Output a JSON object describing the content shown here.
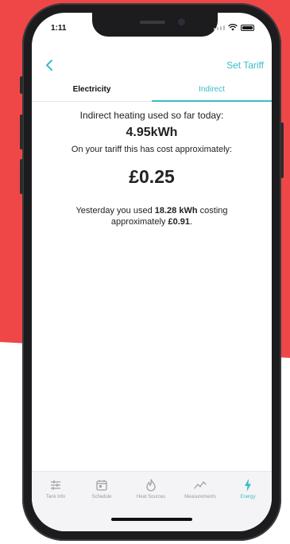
{
  "status": {
    "time": "1:11"
  },
  "nav": {
    "back_icon": "chevron-left-icon",
    "right_action": "Set Tariff"
  },
  "tabs": [
    {
      "label": "Electricity",
      "active": false
    },
    {
      "label": "Indirect",
      "active": true
    }
  ],
  "summary": {
    "today_text": "Indirect heating used so far today:",
    "today_kwh": "4.95kWh",
    "cost_text": "On your tariff this has cost approximately:",
    "cost_value": "£0.25",
    "yesterday_prefix": "Yesterday you used",
    "yesterday_kwh": "18.28 kWh",
    "yesterday_mid": "costing approximately",
    "yesterday_cost": "£0.91",
    "yesterday_suffix": "."
  },
  "tabbar": [
    {
      "label": "Tank Info",
      "icon": "sliders-icon",
      "active": false
    },
    {
      "label": "Schedule",
      "icon": "calendar-icon",
      "active": false
    },
    {
      "label": "Heat Sources",
      "icon": "flame-icon",
      "active": false
    },
    {
      "label": "Measurements",
      "icon": "line-chart-icon",
      "active": false
    },
    {
      "label": "Energy",
      "icon": "lightning-icon",
      "active": true
    }
  ],
  "colors": {
    "accent": "#3bbcc6",
    "background_red": "#ef4747",
    "phone_frame": "#1c1c1e"
  }
}
